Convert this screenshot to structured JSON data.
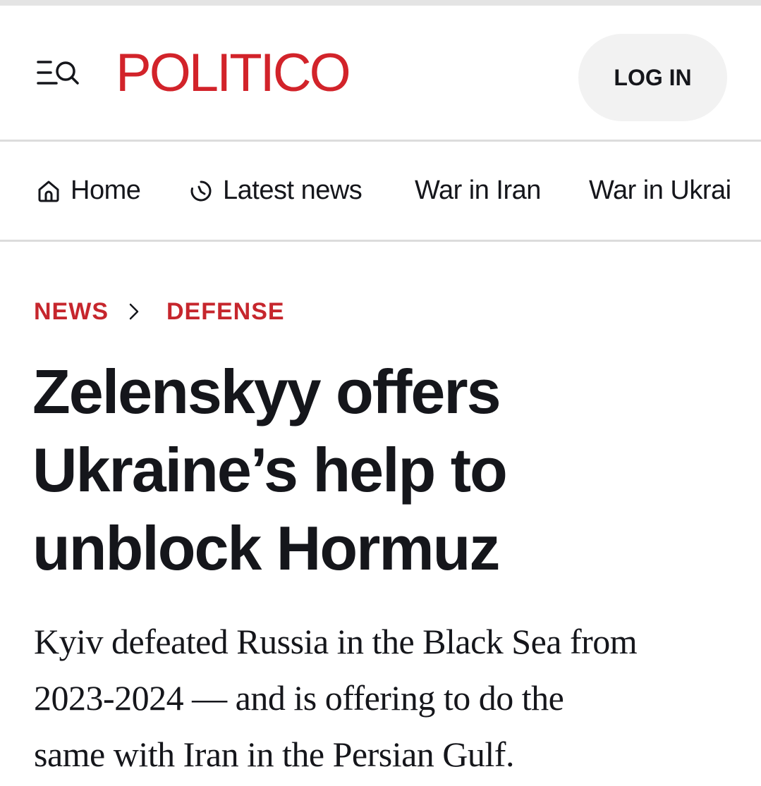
{
  "header": {
    "menu_icon": "menu-search-icon",
    "logo_text": "POLITICO",
    "login_label": "LOG IN",
    "brand_color": "#d2232a"
  },
  "nav": {
    "items": [
      {
        "label": "Home",
        "icon": "home-icon"
      },
      {
        "label": "Latest news",
        "icon": "clock-icon"
      },
      {
        "label": "War in Iran",
        "icon": ""
      },
      {
        "label": "War in Ukrai",
        "icon": ""
      }
    ]
  },
  "breadcrumb": {
    "section": "NEWS",
    "separator_icon": "chevron-right-icon",
    "subsection": "DEFENSE"
  },
  "article": {
    "headline_lines": [
      "Zelenskyy offers",
      "Ukraine’s help to",
      "unblock Hormuz"
    ],
    "dek_lines": [
      "Kyiv defeated Russia in the Black Sea from",
      "2023-2024 — and is offering to do the",
      "same with Iran in the Persian Gulf."
    ]
  }
}
